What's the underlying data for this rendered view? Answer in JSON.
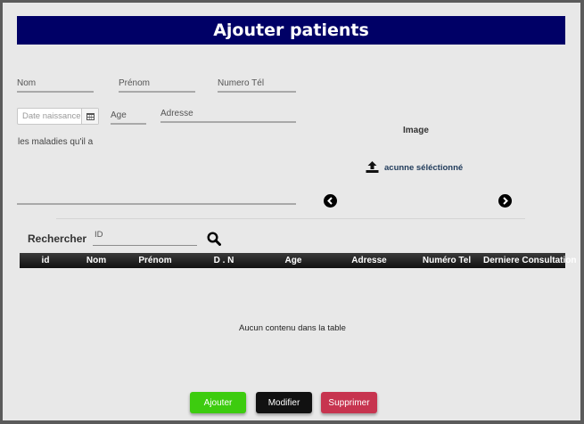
{
  "header": {
    "title": "Ajouter patients"
  },
  "form": {
    "nom_label": "Nom",
    "prenom_label": "Prénom",
    "tel_label": "Numero Tél",
    "date_placeholder": "Date naissance",
    "age_label": "Age",
    "adresse_label": "Adresse",
    "maladies_label": "les maladies qu'il a"
  },
  "image_panel": {
    "title": "Image",
    "upload_label": "acunne séléctionné"
  },
  "search": {
    "label": "Rechercher",
    "placeholder": "ID"
  },
  "table": {
    "columns": [
      "id",
      "Nom",
      "Prénom",
      "D . N",
      "Age",
      "Adresse",
      "Numéro Tel",
      "Derniere Consultation"
    ],
    "empty_text": "Aucun contenu dans la table"
  },
  "actions": {
    "add_label": "Ajouter",
    "edit_label": "Modifier",
    "delete_label": "Supprimer"
  },
  "colors": {
    "header_bg": "#000066",
    "add": "#3dcc0f",
    "edit": "#111111",
    "delete": "#c7344f"
  },
  "icons": {
    "calendar": "calendar-icon",
    "upload": "upload-icon",
    "prev": "arrow-left-circle-icon",
    "next": "arrow-right-circle-icon",
    "search": "search-icon"
  }
}
